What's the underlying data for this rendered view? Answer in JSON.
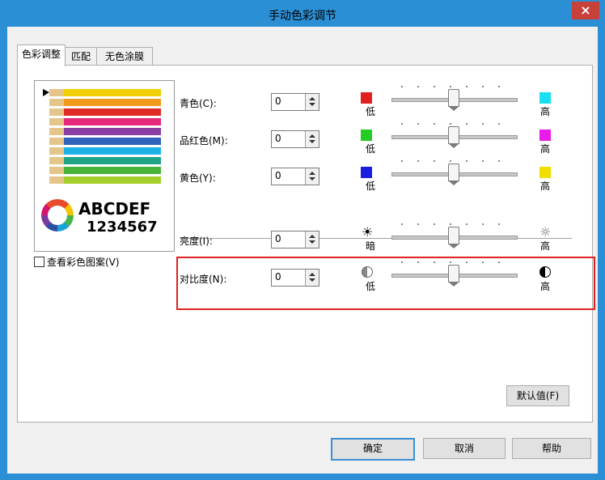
{
  "window": {
    "title": "手动色彩调节",
    "close_label": "×"
  },
  "tabs": [
    {
      "label": "色彩调整"
    },
    {
      "label": "匹配"
    },
    {
      "label": "无色涂膜"
    }
  ],
  "preview": {
    "text_letters": "ABCDEF",
    "text_numbers": "1234567"
  },
  "view_pattern": {
    "label": "查看彩色图案(V)"
  },
  "rows": [
    {
      "label": "青色(C):",
      "value": "0",
      "low": "低",
      "high": "高",
      "low_color": "#e32020",
      "high_color": "#19e0f0"
    },
    {
      "label": "品红色(M):",
      "value": "0",
      "low": "低",
      "high": "高",
      "low_color": "#22cc22",
      "high_color": "#e81ce8"
    },
    {
      "label": "黄色(Y):",
      "value": "0",
      "low": "低",
      "high": "高",
      "low_color": "#1c1ce0",
      "high_color": "#f0e000"
    },
    {
      "label": "亮度(I):",
      "value": "0",
      "low": "暗",
      "high": "高"
    },
    {
      "label": "对比度(N):",
      "value": "0",
      "low": "低",
      "high": "高"
    }
  ],
  "buttons": {
    "defaults": "默认值(F)",
    "ok": "确定",
    "cancel": "取消",
    "help": "帮助"
  }
}
